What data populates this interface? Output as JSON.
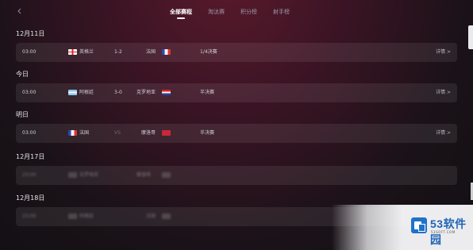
{
  "header": {
    "back_icon": "chevron-left-icon",
    "tabs": [
      {
        "label": "全部赛程",
        "active": true
      },
      {
        "label": "淘汰赛",
        "active": false
      },
      {
        "label": "积分榜",
        "active": false
      },
      {
        "label": "射手榜",
        "active": false
      }
    ]
  },
  "sections": [
    {
      "date": "12月11日",
      "match": {
        "time": "03:00",
        "team1": "英格兰",
        "flag1": "flag-england",
        "score": "1-2",
        "team2": "法国",
        "flag2": "flag-france",
        "stage": "1/4决赛",
        "detail": "详情 >"
      }
    },
    {
      "date": "今日",
      "match": {
        "time": "03:00",
        "team1": "阿根廷",
        "flag1": "flag-argentina",
        "score": "3-0",
        "team2": "克罗地亚",
        "flag2": "flag-croatia",
        "stage": "半决赛",
        "detail": "详情 >"
      }
    },
    {
      "date": "明日",
      "match": {
        "time": "03:00",
        "team1": "法国",
        "flag1": "flag-france",
        "score": "VS",
        "team2": "摩洛哥",
        "flag2": "flag-morocco",
        "stage": "半决赛",
        "detail": "详情 >"
      }
    },
    {
      "date": "12月17日",
      "match": {
        "time": "23:00",
        "team1": "克罗地亚",
        "flag1": "flag-croatia",
        "score": "",
        "team2": "摩洛哥",
        "flag2": "flag-morocco",
        "stage": "",
        "detail": ""
      }
    },
    {
      "date": "12月18日",
      "match": {
        "time": "23:00",
        "team1": "阿根廷",
        "flag1": "flag-argentina",
        "score": "",
        "team2": "法国",
        "flag2": "flag-france",
        "stage": "",
        "detail": ""
      }
    }
  ],
  "watermark": {
    "brand": "53软件园",
    "url": "53SOFT.COM",
    "brand_color": "#1f64b5"
  }
}
